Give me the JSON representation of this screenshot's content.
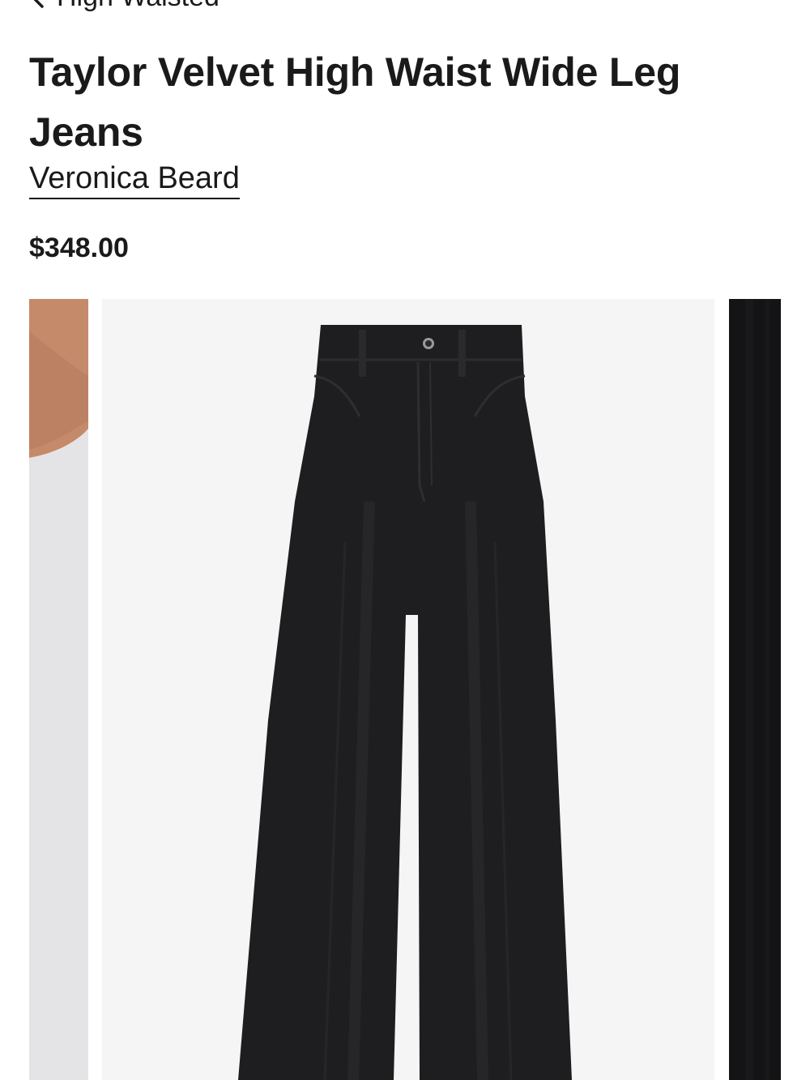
{
  "breadcrumb": {
    "label": "High Waisted"
  },
  "product": {
    "title": "Taylor Velvet High Waist Wide Leg Jeans",
    "brand": "Veronica Beard",
    "price": "$348.00"
  },
  "gallery": {
    "images": [
      {
        "name": "model-arm-photo"
      },
      {
        "name": "black-velvet-jeans-product-photo"
      },
      {
        "name": "velvet-fabric-closeup-photo"
      }
    ]
  },
  "colors": {
    "text": "#1a1a1a",
    "image_bg": "#f5f5f5",
    "garment": "#1e1e20"
  }
}
